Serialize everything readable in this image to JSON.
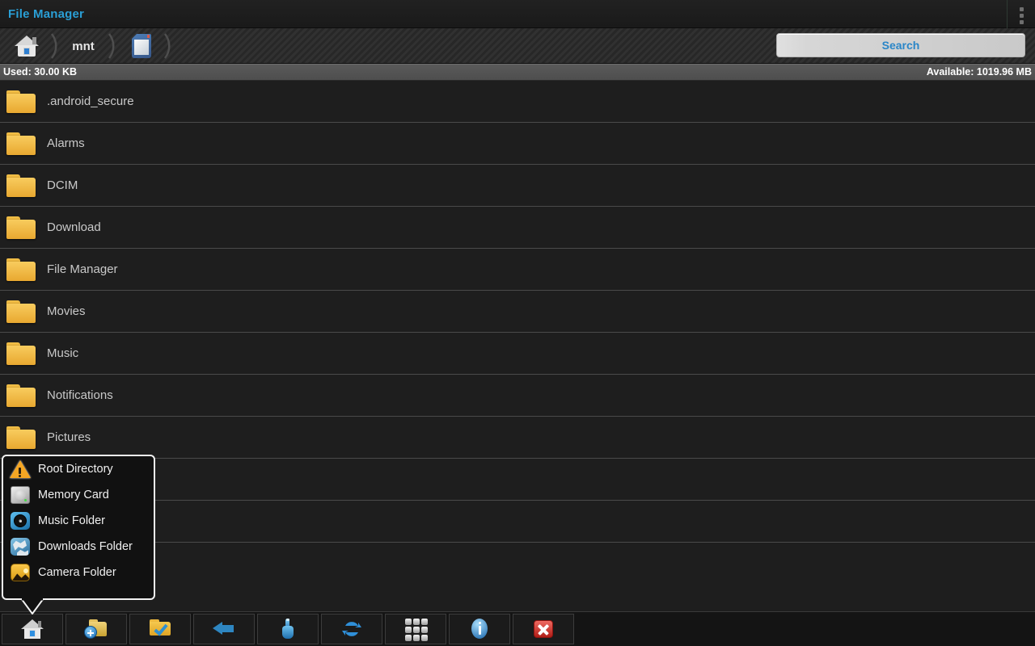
{
  "app": {
    "title": "File Manager",
    "overflow_icon": "overflow-menu-icon"
  },
  "breadcrumb": {
    "items": [
      {
        "icon": "home-icon",
        "label": ""
      },
      {
        "icon": "",
        "label": "mnt"
      },
      {
        "icon": "sdcard-icon",
        "label": ""
      }
    ]
  },
  "search": {
    "label": "Search",
    "placeholder": "Search",
    "icon": "search-icon",
    "text_color": "#2a86c8"
  },
  "storage": {
    "used": "Used: 30.00 KB",
    "available": "Available: 1019.96 MB"
  },
  "file_list": {
    "rows": [
      {
        "icon": "folder-icon",
        "name": ".android_secure"
      },
      {
        "icon": "folder-icon",
        "name": "Alarms"
      },
      {
        "icon": "folder-icon",
        "name": "DCIM"
      },
      {
        "icon": "folder-icon",
        "name": "Download"
      },
      {
        "icon": "folder-icon",
        "name": "File Manager"
      },
      {
        "icon": "folder-icon",
        "name": "Movies"
      },
      {
        "icon": "folder-icon",
        "name": "Music"
      },
      {
        "icon": "folder-icon",
        "name": "Notifications"
      },
      {
        "icon": "folder-icon",
        "name": "Pictures"
      },
      {
        "icon": "",
        "name": ""
      },
      {
        "icon": "",
        "name": ""
      },
      {
        "icon": "",
        "name": ""
      }
    ]
  },
  "popup_menu": {
    "items": [
      {
        "icon": "warning-triangle-icon",
        "label": "Root Directory"
      },
      {
        "icon": "hard-disk-icon",
        "label": "Memory Card"
      },
      {
        "icon": "vinyl-record-icon",
        "label": "Music Folder"
      },
      {
        "icon": "globe-download-icon",
        "label": "Downloads Folder"
      },
      {
        "icon": "picture-landscape-icon",
        "label": "Camera Folder"
      }
    ]
  },
  "toolbar": {
    "buttons": [
      {
        "icon": "home-icon",
        "name": "home-button"
      },
      {
        "icon": "new-folder-icon",
        "name": "new-folder-button"
      },
      {
        "icon": "select-folder-check-icon",
        "name": "select-all-button"
      },
      {
        "icon": "back-arrow-icon",
        "name": "back-button"
      },
      {
        "icon": "hand-select-icon",
        "name": "multi-select-button"
      },
      {
        "icon": "refresh-icon",
        "name": "refresh-button"
      },
      {
        "icon": "grid-view-icon",
        "name": "view-mode-button"
      },
      {
        "icon": "info-icon",
        "name": "info-button"
      },
      {
        "icon": "close-x-icon",
        "name": "exit-button"
      }
    ]
  },
  "colors": {
    "accent": "#2a9fd6",
    "folder": "#f0b429",
    "background": "#1e1e1e",
    "infobar": "#565656"
  }
}
